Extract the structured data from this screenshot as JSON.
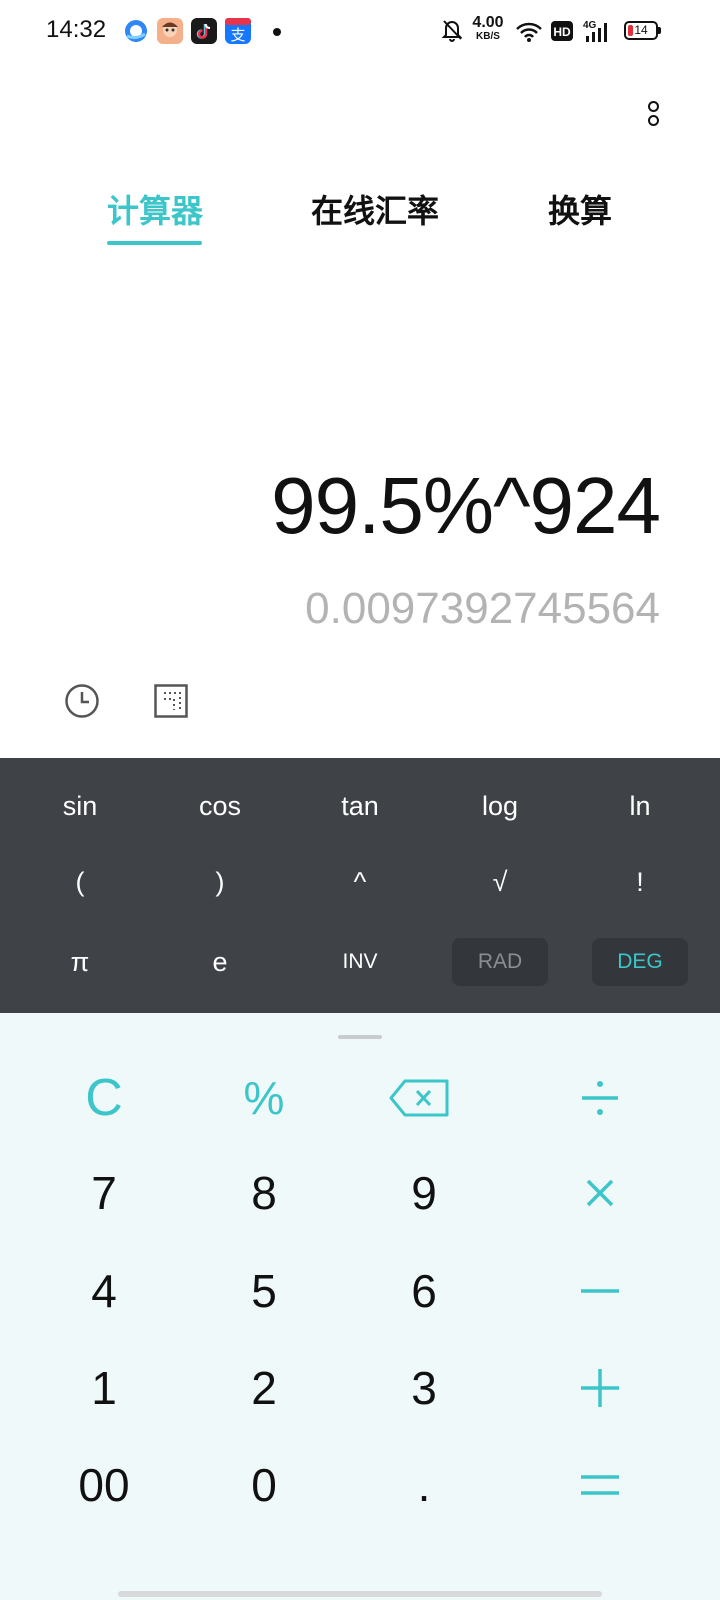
{
  "status_bar": {
    "time": "14:32",
    "net_speed_value": "4.00",
    "net_speed_unit": "KB/S",
    "signal_label": "4G",
    "hd_label": "HD",
    "battery_level": "14",
    "icons": [
      "browser-icon",
      "avatar-app-icon",
      "tiktok-icon",
      "alipay-icon",
      "mute-bell-icon",
      "wifi-icon",
      "hd-icon",
      "signal-icon",
      "battery-icon"
    ]
  },
  "tabs": [
    {
      "label": "计算器",
      "active": true
    },
    {
      "label": "在线汇率",
      "active": false
    },
    {
      "label": "换算",
      "active": false
    }
  ],
  "display": {
    "expression": "99.5%^924",
    "result": "0.0097392745564"
  },
  "scientific": {
    "row1": [
      "sin",
      "cos",
      "tan",
      "log",
      "ln"
    ],
    "row2": [
      "(",
      ")",
      "^",
      "√",
      "!"
    ],
    "row3": [
      "π",
      "e",
      "INV",
      "RAD",
      "DEG"
    ],
    "active_angle_mode": "DEG"
  },
  "keypad": {
    "row1": [
      "C",
      "%",
      "backspace",
      "÷"
    ],
    "row2": [
      "7",
      "8",
      "9",
      "×"
    ],
    "row3": [
      "4",
      "5",
      "6",
      "−"
    ],
    "row4": [
      "1",
      "2",
      "3",
      "+"
    ],
    "row5": [
      "00",
      "0",
      ".",
      "="
    ]
  },
  "colors": {
    "accent": "#3cc6c9",
    "sci_panel": "#3f4247",
    "keypad_bg": "#f0f9fa",
    "result_text": "#b3b3b3"
  }
}
